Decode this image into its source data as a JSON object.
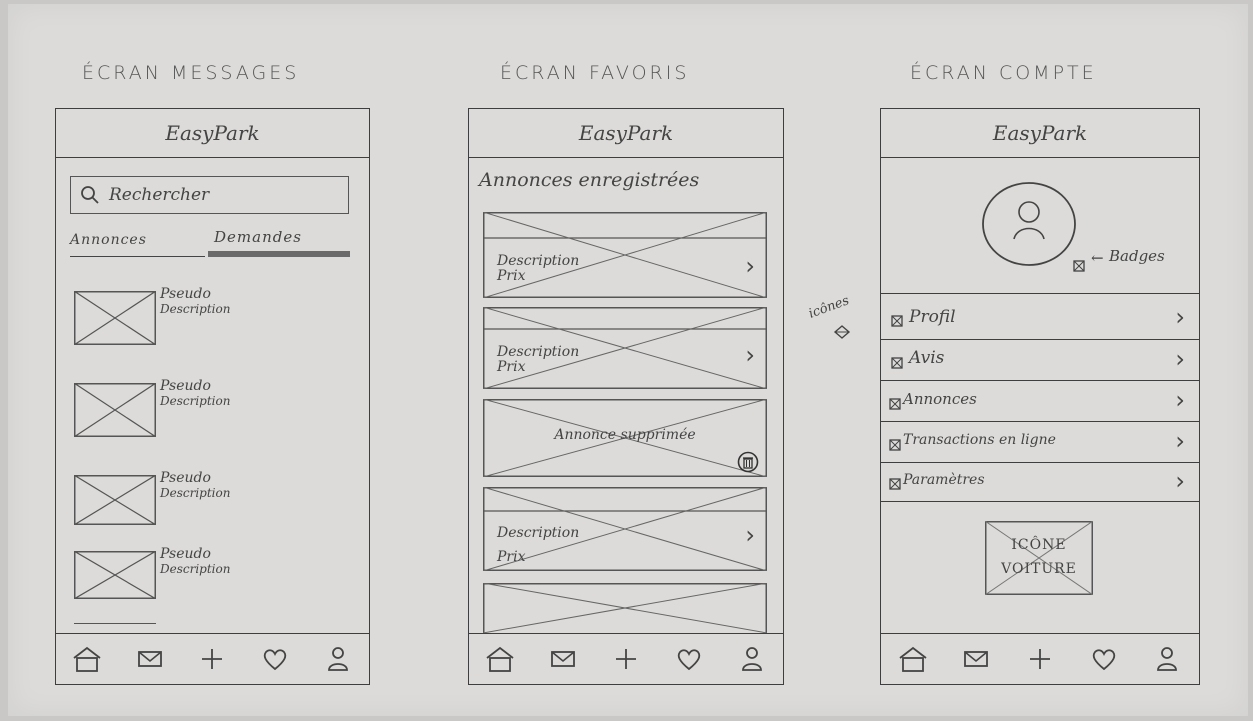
{
  "screens": {
    "messages": {
      "title": "ÉCRAN MESSAGES",
      "app_name": "EasyPark",
      "search_placeholder": "Rechercher",
      "tabs": [
        {
          "label": "Annonces"
        },
        {
          "label": "Demandes"
        }
      ],
      "active_tab": "Demandes",
      "items": [
        {
          "pseudo": "Pseudo",
          "description": "Description"
        },
        {
          "pseudo": "Pseudo",
          "description": "Description"
        },
        {
          "pseudo": "Pseudo",
          "description": "Description"
        },
        {
          "pseudo": "Pseudo",
          "description": "Description"
        }
      ]
    },
    "favoris": {
      "title": "ÉCRAN FAVORIS",
      "app_name": "EasyPark",
      "section_title": "Annonces enregistrées",
      "cards": [
        {
          "description": "Description",
          "price": "Prix"
        },
        {
          "description": "Description",
          "price": "Prix"
        },
        {
          "deleted_label": "Annonce supprimée"
        },
        {
          "description": "Description",
          "price": "Prix"
        }
      ]
    },
    "compte": {
      "title": "ÉCRAN COMPTE",
      "app_name": "EasyPark",
      "badges_label": "Badges",
      "menu": [
        {
          "label": "Profil"
        },
        {
          "label": "Avis"
        },
        {
          "label": "Annonces"
        },
        {
          "label": "Transactions en ligne"
        },
        {
          "label": "Paramètres"
        }
      ],
      "car_icon": {
        "line1": "ICÔNE",
        "line2": "VOITURE"
      }
    }
  },
  "annotation_icones": "icônes",
  "nav_icons": [
    "home-icon",
    "mail-icon",
    "plus-icon",
    "heart-icon",
    "user-icon"
  ]
}
